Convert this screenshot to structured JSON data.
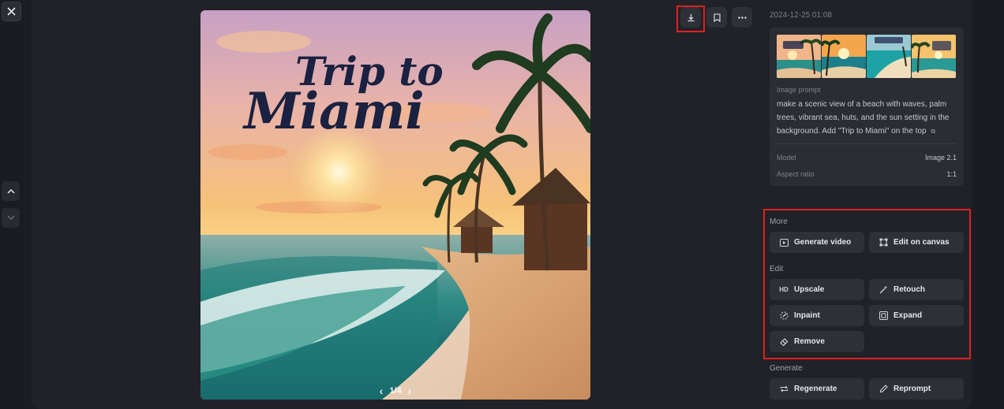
{
  "photo": {
    "overlay_title_line1": "Trip to",
    "overlay_title_line2": "Miami",
    "pager_text": "1/4"
  },
  "icons": {
    "close": "close-icon",
    "nav_up": "chevron-up-icon",
    "nav_down": "chevron-down-icon",
    "download": "download-icon",
    "bookmark": "bookmark-icon",
    "more": "more-dots-icon"
  },
  "details": {
    "date": "2024-12-25 01:08",
    "prompt_label": "Image prompt",
    "prompt_text": "make a scenic view of a beach with waves, palm trees, vibrant sea, huts, and the sun setting in the background. Add \"Trip to Miami\" on the top",
    "model_label": "Model",
    "model_value": "Image 2.1",
    "aspect_label": "Aspect ratio",
    "aspect_value": "1:1"
  },
  "sections": {
    "more": "More",
    "edit": "Edit",
    "generate": "Generate"
  },
  "actions": {
    "generate_video": "Generate video",
    "edit_on_canvas": "Edit on canvas",
    "upscale_badge": "HD",
    "upscale": "Upscale",
    "retouch": "Retouch",
    "inpaint": "Inpaint",
    "expand": "Expand",
    "remove": "Remove",
    "regenerate": "Regenerate",
    "reprompt": "Reprompt"
  },
  "colors": {
    "background": "#1a1c21",
    "panel": "#202227",
    "card": "#2a2d33",
    "button": "#2d3037",
    "highlight_red": "#e0201f"
  }
}
